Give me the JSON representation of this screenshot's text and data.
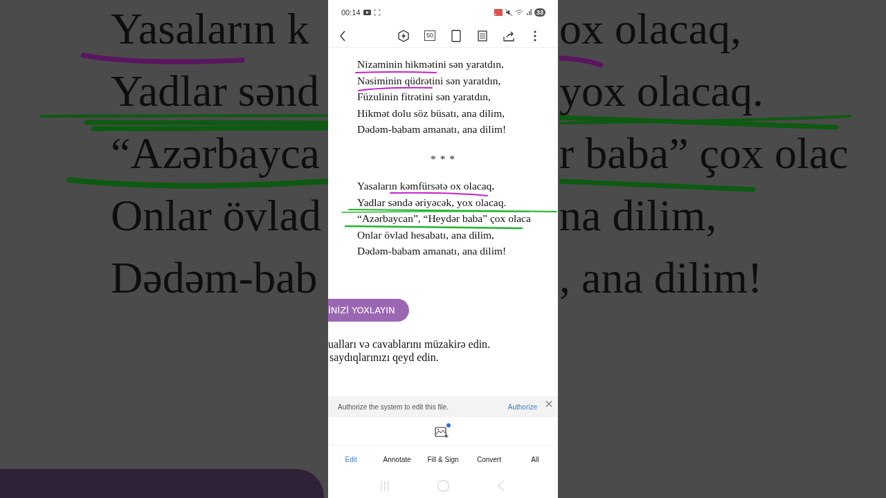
{
  "backdrop": {
    "left_lines": [
      "Yasaların k",
      "Yadlar sənd",
      "“Azərbayca",
      "Onlar övlad",
      "Dədəm-bab"
    ],
    "right_lines": [
      "ox olacaq,",
      "yox olacaq.",
      "r baba” çox olac",
      "na dilim,",
      ", ana dilim!"
    ]
  },
  "status_bar": {
    "time": "00:14",
    "battery": "33"
  },
  "toolbar": {
    "page_size": "50"
  },
  "document": {
    "stanzas": [
      {
        "lines": [
          "Nizaminin hikmətini sən yaratdın,",
          "Nəsiminin qüdrətini sən yaratdın,",
          "Füzulinin fitrətini sən yaratdın,",
          "Hikmət dolu söz büsatı, ana dilim,",
          "Dədəm-babam amanatı, ana dilim!"
        ]
      },
      {
        "lines": [
          "Yasaların kəmfürsətə ox olacaq,",
          "Yadlar səndə əriyəcək, yox olacaq.",
          "“Azərbaycan”, “Heydər baba” çox olaca",
          "Onlar övlad hesabatı, ana dilim,",
          "Dədəm-babam amanatı, ana dilim!"
        ]
      }
    ],
    "separator": "* * *",
    "section_label": "İNİZİ YOXLAYIN",
    "instructions": [
      "ualları və cavablarını müzakirə edin.",
      "saydıqlarınızı qeyd edin."
    ]
  },
  "auth_banner": {
    "message": "Authorize the system to edit this file.",
    "action": "Authorize"
  },
  "tabs": [
    {
      "label": "Edit",
      "selected": true
    },
    {
      "label": "Annotate",
      "selected": false
    },
    {
      "label": "Fill & Sign",
      "selected": false
    },
    {
      "label": "Convert",
      "selected": false
    },
    {
      "label": "All",
      "selected": false
    }
  ]
}
